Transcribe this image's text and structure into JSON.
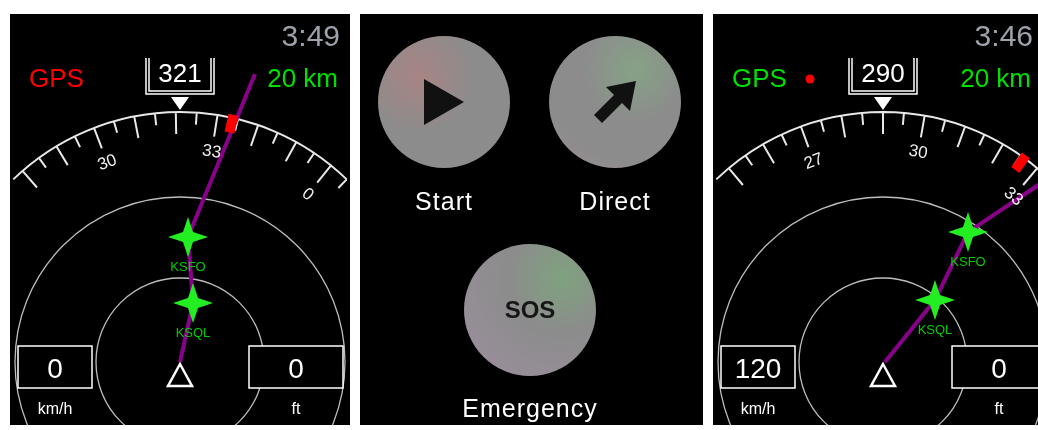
{
  "screens": [
    {
      "kind": "map",
      "time": "3:49",
      "gps": {
        "label": "GPS",
        "fix": false,
        "recording": false
      },
      "heading": "321",
      "range": "20 km",
      "compass_labels": [
        "30",
        "33",
        "0"
      ],
      "waypoints": [
        {
          "name": "KSFO"
        },
        {
          "name": "KSQL"
        }
      ],
      "speed": {
        "value": "0",
        "unit": "km/h"
      },
      "altitude": {
        "value": "0",
        "unit": "ft"
      }
    },
    {
      "kind": "menu",
      "buttons": [
        {
          "kind": "play",
          "label": "Start"
        },
        {
          "kind": "arrow",
          "label": "Direct"
        },
        {
          "kind": "text",
          "icon_text": "SOS",
          "label": "Emergency"
        }
      ]
    },
    {
      "kind": "map",
      "time": "3:46",
      "gps": {
        "label": "GPS",
        "fix": true,
        "recording": true
      },
      "heading": "290",
      "range": "20 km",
      "compass_labels": [
        "27",
        "30",
        "33"
      ],
      "waypoints": [
        {
          "name": "KSFO"
        },
        {
          "name": "KSQL"
        }
      ],
      "speed": {
        "value": "120",
        "unit": "km/h"
      },
      "altitude": {
        "value": "0",
        "unit": "ft"
      }
    }
  ]
}
